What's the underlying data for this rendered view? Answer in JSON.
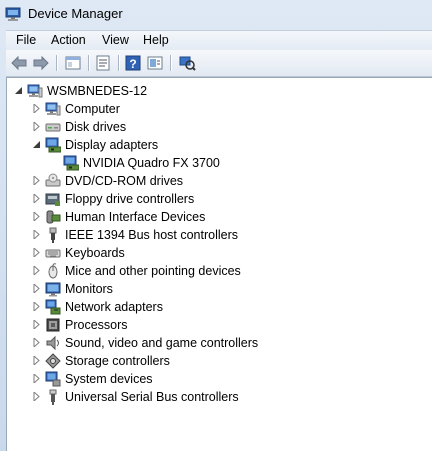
{
  "window": {
    "title": "Device Manager",
    "title_icon": "device-manager-icon"
  },
  "menu": {
    "file": "File",
    "action": "Action",
    "view": "View",
    "help": "Help"
  },
  "toolbar": {
    "buttons": [
      "back-arrow-icon",
      "forward-arrow-icon",
      "show-hide-tree-icon",
      "properties-icon",
      "help-icon",
      "update-driver-icon",
      "scan-hardware-icon"
    ]
  },
  "tree": {
    "root": {
      "label": "WSMBNEDES-12",
      "icon": "computer-icon",
      "expanded": true
    },
    "items": [
      {
        "label": "Computer",
        "icon": "computer-icon",
        "expanded": false
      },
      {
        "label": "Disk drives",
        "icon": "disk-drive-icon",
        "expanded": false
      },
      {
        "label": "Display adapters",
        "icon": "display-adapter-icon",
        "expanded": true,
        "children": [
          {
            "label": "NVIDIA Quadro FX 3700",
            "icon": "display-adapter-icon"
          }
        ]
      },
      {
        "label": "DVD/CD-ROM drives",
        "icon": "dvd-drive-icon",
        "expanded": false
      },
      {
        "label": "Floppy drive controllers",
        "icon": "floppy-controller-icon",
        "expanded": false
      },
      {
        "label": "Human Interface Devices",
        "icon": "hid-icon",
        "expanded": false
      },
      {
        "label": "IEEE 1394 Bus host controllers",
        "icon": "ieee1394-icon",
        "expanded": false
      },
      {
        "label": "Keyboards",
        "icon": "keyboard-icon",
        "expanded": false
      },
      {
        "label": "Mice and other pointing devices",
        "icon": "mouse-icon",
        "expanded": false
      },
      {
        "label": "Monitors",
        "icon": "monitor-icon",
        "expanded": false
      },
      {
        "label": "Network adapters",
        "icon": "network-adapter-icon",
        "expanded": false
      },
      {
        "label": "Processors",
        "icon": "processor-icon",
        "expanded": false
      },
      {
        "label": "Sound, video and game controllers",
        "icon": "sound-icon",
        "expanded": false
      },
      {
        "label": "Storage controllers",
        "icon": "storage-controller-icon",
        "expanded": false
      },
      {
        "label": "System devices",
        "icon": "system-devices-icon",
        "expanded": false
      },
      {
        "label": "Universal Serial Bus controllers",
        "icon": "usb-icon",
        "expanded": false
      }
    ]
  }
}
